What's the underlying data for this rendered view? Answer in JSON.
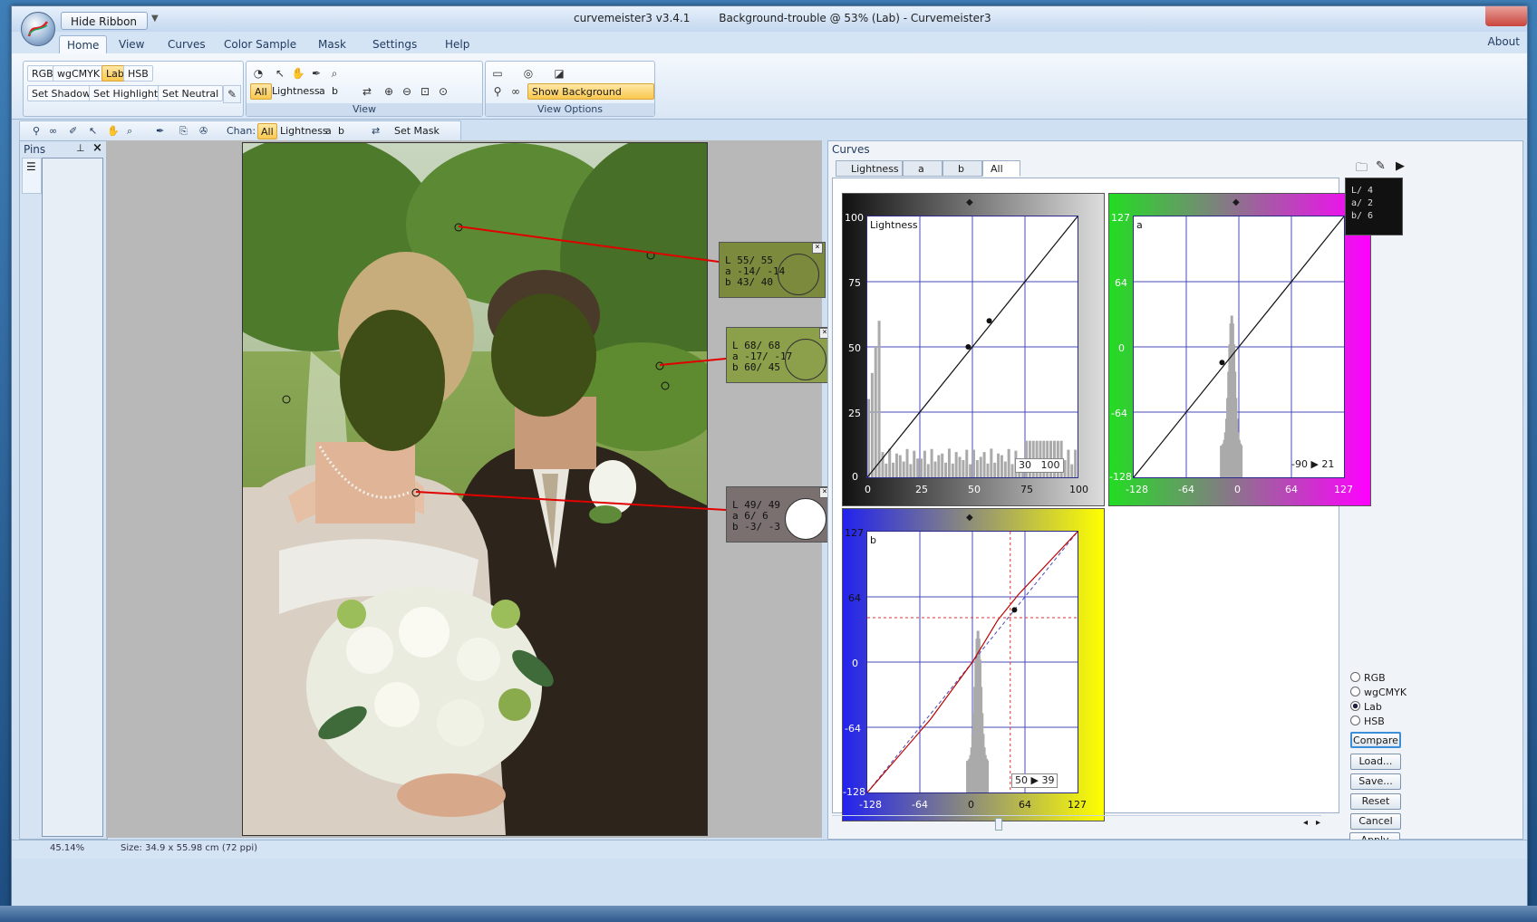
{
  "window": {
    "title_version": "curvemeister3 v3.4.1",
    "title_doc": "Background-trouble @ 53% (Lab) - Curvemeister3"
  },
  "quick_access": {
    "hide_ribbon": "Hide Ribbon"
  },
  "ribbon_tabs": [
    "Home",
    "View",
    "Curves",
    "Color Sample",
    "Mask",
    "Settings",
    "Help"
  ],
  "about": "About",
  "mode_group": {
    "modes": [
      "RGB",
      "wgCMYK",
      "Lab",
      "HSB"
    ],
    "active": "Lab",
    "buttons": [
      "Set Shadow",
      "Set Highlight",
      "Set Neutral"
    ]
  },
  "view_group": {
    "label": "View",
    "channels": [
      "All",
      "Lightness",
      "a",
      "b"
    ]
  },
  "view_options_group": {
    "label": "View Options",
    "show_bg": "Show Background Layers"
  },
  "toolbar": {
    "chan_label": "Chan:",
    "channels": [
      "All",
      "Lightness",
      "a",
      "b"
    ],
    "set_mask": "Set Mask"
  },
  "pins": {
    "title": "Pins"
  },
  "samples": [
    {
      "L": "L  55/ 55",
      "a": "a -14/ -14",
      "b": "b  43/  40",
      "bg": "#7c8a3e"
    },
    {
      "L": "L  68/ 68",
      "a": "a -17/ -17",
      "b": "b  60/  45",
      "bg": "#8c9f4a"
    },
    {
      "L": "L  49/ 49",
      "a": "a   6/   6",
      "b": "b  -3/  -3",
      "bg": "#7a7070"
    }
  ],
  "curves": {
    "title": "Curves",
    "tabs": [
      "Lightness",
      "a",
      "b",
      "All"
    ],
    "active_tab": "All",
    "lightness": {
      "name": "Lightness",
      "yticks": [
        "100",
        "75",
        "50",
        "25",
        "0"
      ],
      "xticks": [
        "0",
        "25",
        "50",
        "75",
        "100"
      ],
      "readout_in": "30",
      "readout_out": "100"
    },
    "a": {
      "name": "a",
      "yticks": [
        "127",
        "64",
        "0",
        "-64",
        "-128"
      ],
      "xticks": [
        "-128",
        "-64",
        "0",
        "64",
        "127"
      ],
      "readout": "-90 ▶ 21"
    },
    "b": {
      "name": "b",
      "yticks": [
        "127",
        "64",
        "0",
        "-64",
        "-128"
      ],
      "xticks": [
        "-128",
        "-64",
        "0",
        "64",
        "127"
      ],
      "readout_in": "50",
      "readout_out": "39"
    }
  },
  "mini_dial": {
    "L": "L/  4",
    "a": "a/  2",
    "b": "b/  6"
  },
  "color_modes": [
    "RGB",
    "wgCMYK",
    "Lab",
    "HSB"
  ],
  "selected_color_mode": "Lab",
  "side_buttons": [
    "Compare",
    "Load...",
    "Save...",
    "Reset",
    "Cancel",
    "Apply"
  ],
  "status": {
    "zoom": "45.14%",
    "size": "Size: 34.9 x 55.98 cm (72 ppi)"
  },
  "colors": {
    "accent": "#f9c84f",
    "ribbon": "#d9e6f5",
    "magenta": "#ff00ff",
    "yellow": "#ffff00",
    "sampler_line": "#e00000"
  }
}
